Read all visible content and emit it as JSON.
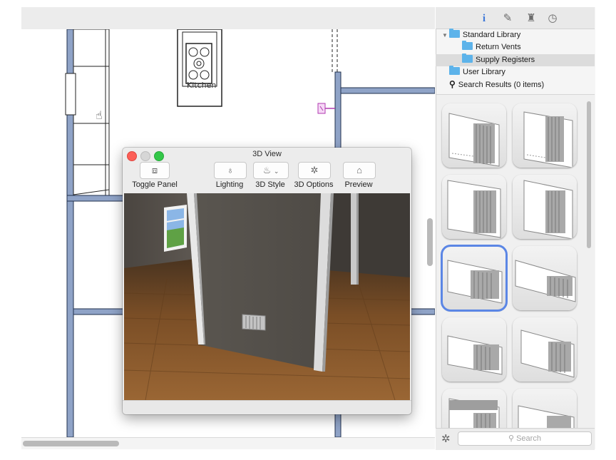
{
  "sidebar": {
    "tabs": [
      {
        "name": "info-icon",
        "glyph": "i"
      },
      {
        "name": "pencil-icon",
        "glyph": "✎"
      },
      {
        "name": "chair-icon",
        "glyph": "♜"
      },
      {
        "name": "timer-icon",
        "glyph": "◷"
      }
    ],
    "tree": {
      "standard_library": "Standard Library",
      "return_vents": "Return Vents",
      "supply_registers": "Supply Registers",
      "user_library": "User Library",
      "search_results": "Search Results (0 items)"
    },
    "search_placeholder": "Search",
    "selected_thumbnail": 5
  },
  "plan": {
    "room_label": "Kitchen"
  },
  "view3d": {
    "title": "3D View",
    "toolbar": {
      "toggle_panel": "Toggle Panel",
      "lighting": "Lighting",
      "style_3d": "3D Style",
      "options_3d": "3D Options",
      "preview": "Preview"
    }
  },
  "colors": {
    "wall_blue": "#8fa3c7",
    "selection_blue": "#5b86e5",
    "folder_blue": "#5db3ea",
    "floor_wood": "#8a5a2b"
  }
}
